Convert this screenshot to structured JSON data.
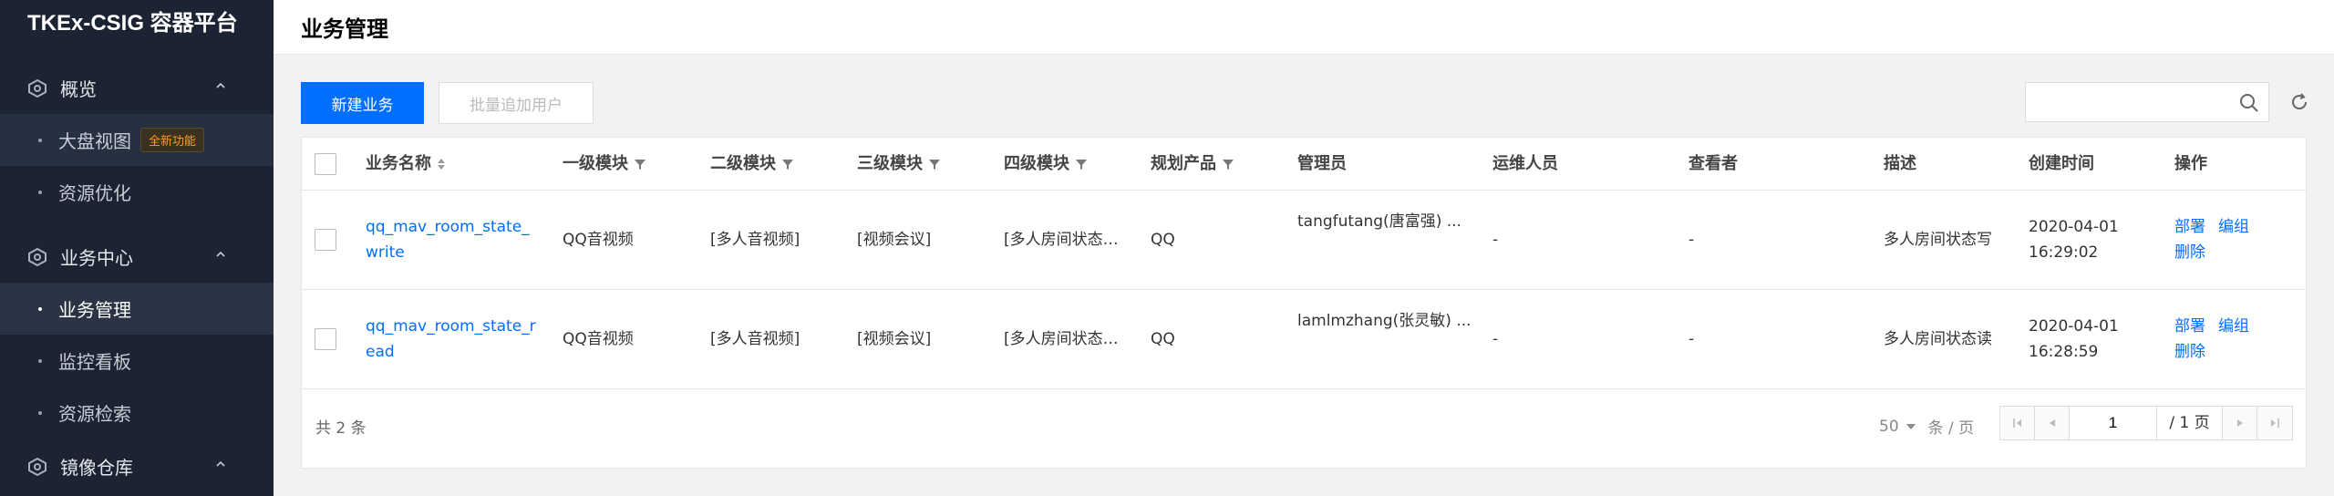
{
  "app": {
    "brand": "TKEx-CSIG 容器平台"
  },
  "sidebar": {
    "sections": [
      {
        "title": "概览",
        "icon": "overview-icon"
      },
      {
        "title": "业务中心",
        "icon": "business-icon"
      },
      {
        "title": "镜像仓库",
        "icon": "registry-icon"
      }
    ],
    "items": [
      {
        "label": "大盘视图",
        "badge": "全新功能"
      },
      {
        "label": "资源优化"
      },
      {
        "label": "业务管理"
      },
      {
        "label": "监控看板"
      },
      {
        "label": "资源检索"
      }
    ]
  },
  "header": {
    "title": "业务管理"
  },
  "toolbar": {
    "new_label": "新建业务",
    "batch_label": "批量追加用户",
    "search_placeholder": ""
  },
  "table": {
    "columns": [
      "业务名称",
      "一级模块",
      "二级模块",
      "三级模块",
      "四级模块",
      "规划产品",
      "管理员",
      "运维人员",
      "查看者",
      "描述",
      "创建时间",
      "操作"
    ],
    "rows": [
      {
        "name_line1": "qq_mav_room_state_",
        "name_line2": "write",
        "m1": "QQ音视频",
        "m2": "[多人音视频]",
        "m3": "[视频会议]",
        "m4": "[多人房间状态…",
        "product": "QQ",
        "admin": "tangfutang(唐富强) ...",
        "ops_staff": "-",
        "viewer": "-",
        "desc": "多人房间状态写",
        "date": "2020-04-01",
        "time": "16:29:02",
        "act_deploy": "部署",
        "act_edit": "编组",
        "act_delete": "删除"
      },
      {
        "name_line1": "qq_mav_room_state_r",
        "name_line2": "ead",
        "m1": "QQ音视频",
        "m2": "[多人音视频]",
        "m3": "[视频会议]",
        "m4": "[多人房间状态…",
        "product": "QQ",
        "admin": "lamlmzhang(张灵敏) ...",
        "ops_staff": "-",
        "viewer": "-",
        "desc": "多人房间状态读",
        "date": "2020-04-01",
        "time": "16:28:59",
        "act_deploy": "部署",
        "act_edit": "编组",
        "act_delete": "删除"
      }
    ]
  },
  "footer": {
    "total": "共 2 条",
    "page_size": "50",
    "page_size_unit": "条 / 页",
    "current_page": "1",
    "total_pages": "/ 1 页"
  },
  "colors": {
    "accent": "#006eff",
    "sidebar_bg": "#1c2433",
    "badge": "#ff9c19"
  }
}
